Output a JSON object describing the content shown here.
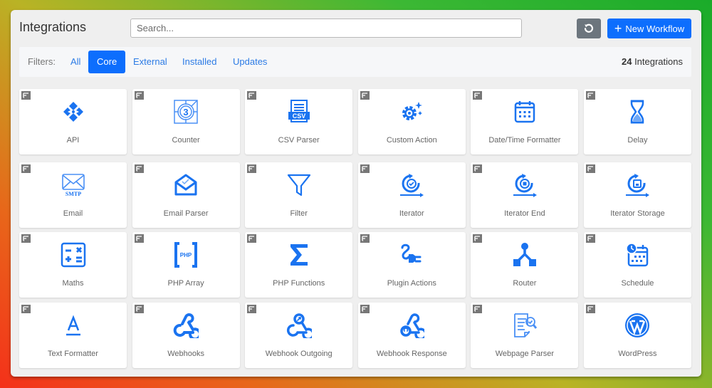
{
  "header": {
    "title": "Integrations",
    "search_placeholder": "Search...",
    "search_value": "",
    "refresh_icon": "refresh-icon",
    "new_workflow_label": "New Workflow",
    "new_workflow_icon": "plus-icon"
  },
  "filters": {
    "label": "Filters:",
    "items": [
      {
        "label": "All",
        "active": false
      },
      {
        "label": "Core",
        "active": true
      },
      {
        "label": "External",
        "active": false
      },
      {
        "label": "Installed",
        "active": false
      },
      {
        "label": "Updates",
        "active": false
      }
    ],
    "count_number": "24",
    "count_label": "Integrations"
  },
  "colors": {
    "accent": "#0d6efd",
    "icon_blue": "#1a73f0",
    "secondary_button": "#6c757d"
  },
  "integrations": [
    {
      "name": "API",
      "icon": "api-icon"
    },
    {
      "name": "Counter",
      "icon": "counter-icon"
    },
    {
      "name": "CSV Parser",
      "icon": "csv-icon"
    },
    {
      "name": "Custom Action",
      "icon": "gear-sparkle-icon"
    },
    {
      "name": "Date/Time Formatter",
      "icon": "calendar-icon"
    },
    {
      "name": "Delay",
      "icon": "hourglass-icon"
    },
    {
      "name": "Email",
      "icon": "smtp-envelope-icon"
    },
    {
      "name": "Email Parser",
      "icon": "open-envelope-icon"
    },
    {
      "name": "Filter",
      "icon": "funnel-icon"
    },
    {
      "name": "Iterator",
      "icon": "iterator-check-icon"
    },
    {
      "name": "Iterator End",
      "icon": "iterator-stop-icon"
    },
    {
      "name": "Iterator Storage",
      "icon": "iterator-save-icon"
    },
    {
      "name": "Maths",
      "icon": "calculator-icon"
    },
    {
      "name": "PHP Array",
      "icon": "php-brackets-icon"
    },
    {
      "name": "PHP Functions",
      "icon": "sigma-icon"
    },
    {
      "name": "Plugin Actions",
      "icon": "plug-icon"
    },
    {
      "name": "Router",
      "icon": "router-icon"
    },
    {
      "name": "Schedule",
      "icon": "calendar-clock-icon"
    },
    {
      "name": "Text Formatter",
      "icon": "text-format-icon"
    },
    {
      "name": "Webhooks",
      "icon": "webhook-icon"
    },
    {
      "name": "Webhook Outgoing",
      "icon": "webhook-outgoing-icon"
    },
    {
      "name": "Webhook Response",
      "icon": "webhook-response-icon"
    },
    {
      "name": "Webpage Parser",
      "icon": "document-search-icon"
    },
    {
      "name": "WordPress",
      "icon": "wordpress-icon"
    }
  ]
}
